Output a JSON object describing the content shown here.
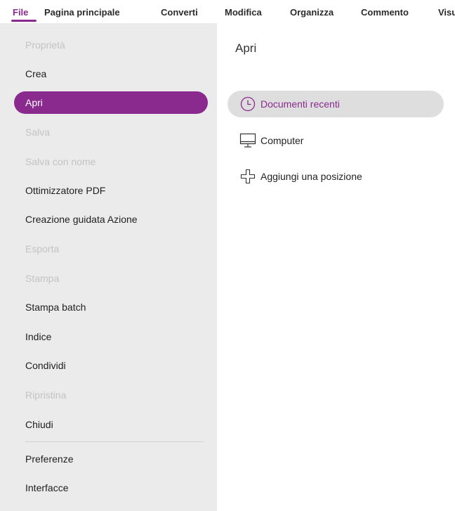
{
  "ribbon": {
    "tabs": [
      {
        "label": "File",
        "active": true
      },
      {
        "label": "Pagina principale"
      },
      {
        "label": "Converti"
      },
      {
        "label": "Modifica"
      },
      {
        "label": "Organizza"
      },
      {
        "label": "Commento"
      },
      {
        "label": "Visu"
      }
    ]
  },
  "sidebar": {
    "items": [
      {
        "label": "Proprietà",
        "state": "disabled"
      },
      {
        "label": "Crea",
        "state": "enabled"
      },
      {
        "label": "Apri",
        "state": "selected"
      },
      {
        "label": "Salva",
        "state": "disabled"
      },
      {
        "label": "Salva con nome",
        "state": "disabled"
      },
      {
        "label": "Ottimizzatore PDF",
        "state": "enabled"
      },
      {
        "label": "Creazione guidata Azione",
        "state": "enabled"
      },
      {
        "label": "Esporta",
        "state": "disabled"
      },
      {
        "label": "Stampa",
        "state": "disabled"
      },
      {
        "label": "Stampa batch",
        "state": "enabled"
      },
      {
        "label": "Indice",
        "state": "enabled"
      },
      {
        "label": "Condividi",
        "state": "enabled"
      },
      {
        "label": "Ripristina",
        "state": "disabled"
      },
      {
        "label": "Chiudi",
        "state": "enabled"
      },
      {
        "label": "Preferenze",
        "state": "enabled"
      },
      {
        "label": "Interfacce",
        "state": "enabled"
      }
    ]
  },
  "main": {
    "title": "Apri",
    "options": [
      {
        "label": "Documenti recenti",
        "icon": "clock-icon",
        "selected": true
      },
      {
        "label": "Computer",
        "icon": "computer-icon"
      },
      {
        "label": "Aggiungi una posizione",
        "icon": "plus-icon"
      }
    ]
  },
  "colors": {
    "accent": "#8a2a8f",
    "sidebar_bg": "#ebebeb",
    "disabled_text": "#c3c3c3",
    "selected_option_bg": "#dedede"
  }
}
